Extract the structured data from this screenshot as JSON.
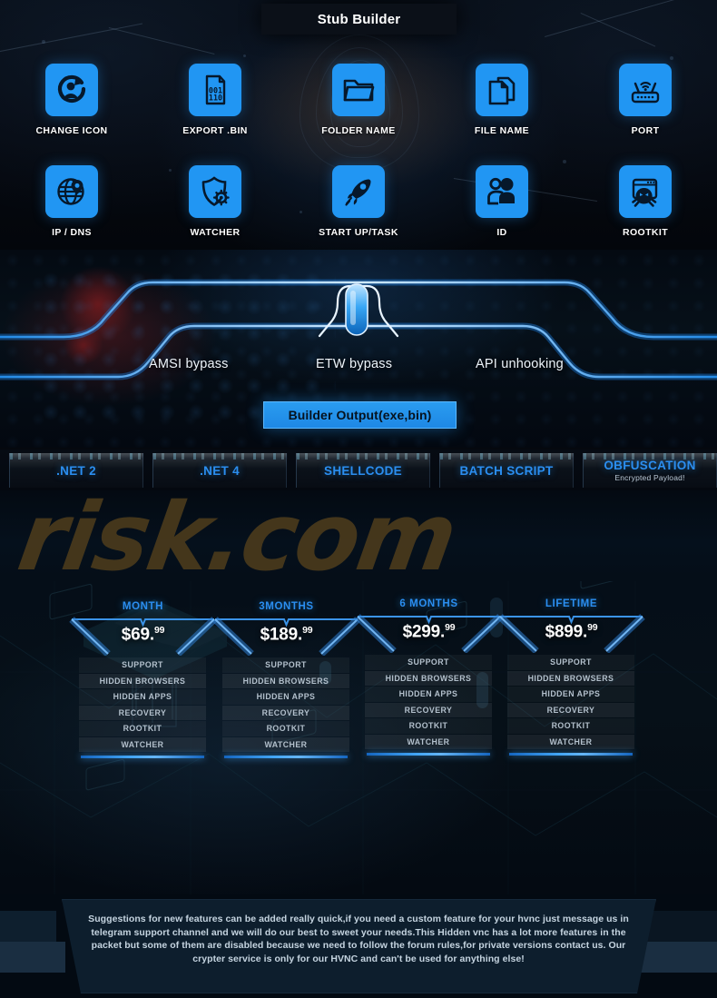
{
  "header": {
    "title": "Stub Builder"
  },
  "stub_builder": {
    "options": [
      {
        "label": "CHANGE ICON",
        "icon": "user-refresh-icon"
      },
      {
        "label": "EXPORT .BIN",
        "icon": "binary-file-icon"
      },
      {
        "label": "FOLDER NAME",
        "icon": "folder-icon"
      },
      {
        "label": "FILE NAME",
        "icon": "copy-files-icon"
      },
      {
        "label": "PORT",
        "icon": "router-icon"
      },
      {
        "label": "IP / DNS",
        "icon": "globe-pin-icon"
      },
      {
        "label": "WATCHER",
        "icon": "shield-gear-icon"
      },
      {
        "label": "START UP/TASK",
        "icon": "rocket-icon"
      },
      {
        "label": "ID",
        "icon": "users-icon"
      },
      {
        "label": "ROOTKIT",
        "icon": "monitor-ghost-icon"
      }
    ]
  },
  "bypass": {
    "features": [
      {
        "label": "AMSI bypass"
      },
      {
        "label": "ETW bypass"
      },
      {
        "label": "API unhooking"
      }
    ],
    "output_button": "Builder Output(exe,bin)"
  },
  "format_tabs": [
    {
      "name": ".NET 2",
      "sub": ""
    },
    {
      "name": ".NET 4",
      "sub": ""
    },
    {
      "name": "SHELLCODE",
      "sub": ""
    },
    {
      "name": "BATCH SCRIPT",
      "sub": ""
    },
    {
      "name": "OBFUSCATION",
      "sub": "Encrypted Payload!"
    }
  ],
  "watermark": {
    "text": "risk.com"
  },
  "pricing": {
    "plans": [
      {
        "title": "MONTH",
        "price_main": "$69.",
        "price_cents": "99",
        "features": [
          "SUPPORT",
          "HIDDEN BROWSERS",
          "HIDDEN APPS",
          "RECOVERY",
          "ROOTKIT",
          "WATCHER"
        ]
      },
      {
        "title": "3MONTHS",
        "price_main": "$189.",
        "price_cents": "99",
        "features": [
          "SUPPORT",
          "HIDDEN BROWSERS",
          "HIDDEN APPS",
          "RECOVERY",
          "ROOTKIT",
          "WATCHER"
        ]
      },
      {
        "title": "6 MONTHS",
        "price_main": "$299.",
        "price_cents": "99",
        "features": [
          "SUPPORT",
          "HIDDEN BROWSERS",
          "HIDDEN APPS",
          "RECOVERY",
          "ROOTKIT",
          "WATCHER"
        ]
      },
      {
        "title": "LIFETIME",
        "price_main": "$899.",
        "price_cents": "99",
        "features": [
          "SUPPORT",
          "HIDDEN BROWSERS",
          "HIDDEN APPS",
          "RECOVERY",
          "ROOTKIT",
          "WATCHER"
        ]
      }
    ]
  },
  "footer": {
    "note": "Suggestions for new features can be added really quick,if you need a custom feature for your hvnc just message us in telegram support channel and we will do our best to sweet your needs.This Hidden vnc has a lot more features in the packet but some of them are disabled because we need to follow the forum rules,for private versions contact us.\nOur crypter service is only for our HVNC and can't be used for anything else!"
  },
  "colors": {
    "accent_blue": "#2196F3",
    "tab_blue": "#2b8ef0",
    "panel_dark": "#0d1e2d",
    "watermark": "#4a3a1c"
  }
}
